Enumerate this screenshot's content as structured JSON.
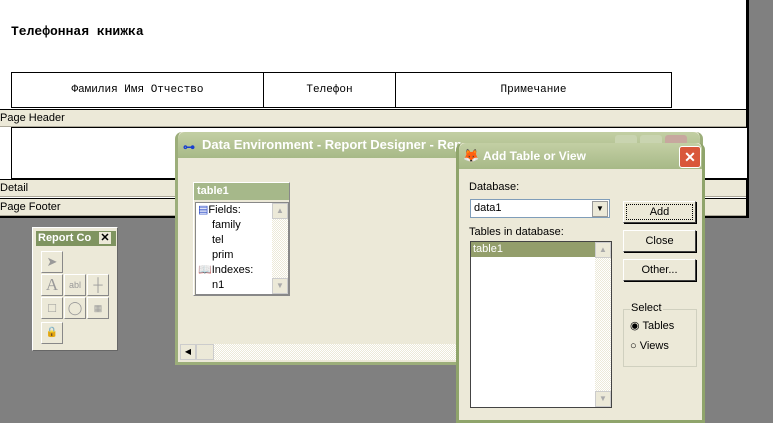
{
  "report": {
    "title": "Телефонная книжка",
    "columns": [
      "Фамилия Имя Отчество",
      "Телефон",
      "Примечание"
    ],
    "bands": {
      "page_header": "Page Header",
      "detail": "Detail",
      "page_footer": "Page Footer"
    }
  },
  "report_controls": {
    "title": "Report Co",
    "tools": [
      "pointer",
      "label",
      "field",
      "line",
      "rectangle",
      "rounded-rectangle",
      "picture-ole",
      "lock"
    ],
    "field_glyph": "abl",
    "label_glyph": "A"
  },
  "data_env": {
    "title": "Data Environment - Report Designer - Rep",
    "table": {
      "name": "table1",
      "items": [
        "Fields:",
        "family",
        "tel",
        "prim",
        "Indexes:",
        "n1"
      ]
    }
  },
  "dialog": {
    "title": "Add Table or View",
    "database_label": "Database:",
    "database_value": "data1",
    "tables_label": "Tables in database:",
    "tables": [
      "table1"
    ],
    "buttons": {
      "add": "Add",
      "close": "Close",
      "other": "Other..."
    },
    "select": {
      "label": "Select",
      "options": [
        "Tables",
        "Views"
      ],
      "selected": "Tables"
    }
  },
  "colors": {
    "title_green": "#a7b987",
    "selection": "#939e6b",
    "close_red": "#d9573a"
  }
}
